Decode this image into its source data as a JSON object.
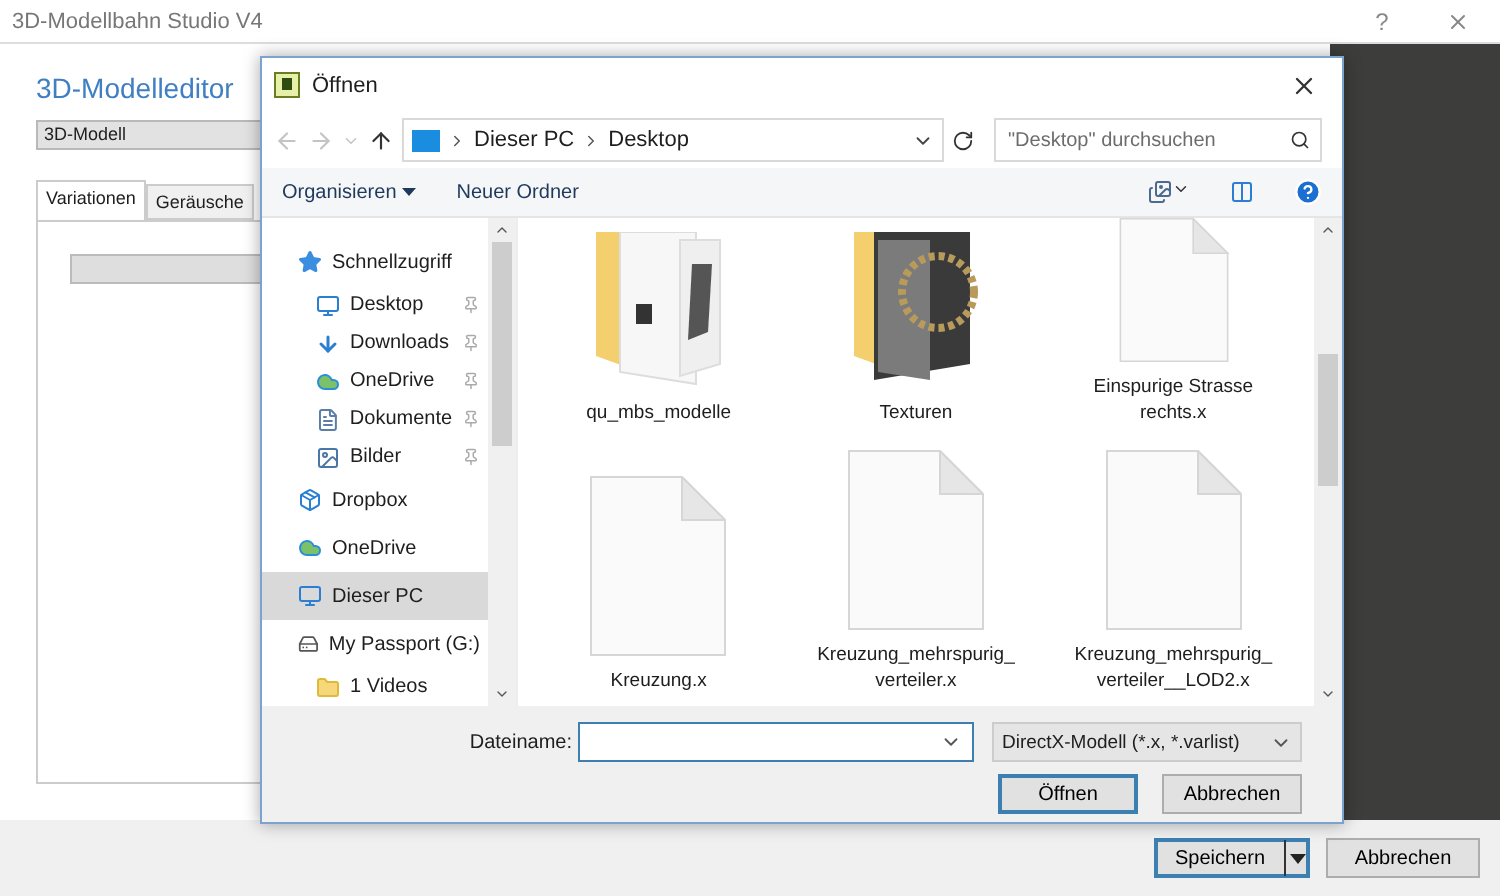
{
  "app": {
    "title": "3D-Modellbahn Studio V4",
    "help": "?",
    "heading": "3D-Modelleditor",
    "model_select": "3D-Modell",
    "tabs": [
      {
        "label": "Variationen",
        "selected": true
      },
      {
        "label": "Geräusche",
        "selected": false
      }
    ],
    "buttons": [
      {
        "label": "Speichern",
        "default": true,
        "split": true
      },
      {
        "label": "Abbrechen",
        "default": false,
        "split": false
      }
    ]
  },
  "dialog": {
    "title": "Öffnen",
    "path": [
      "Dieser PC",
      "Desktop"
    ],
    "search": {
      "placeholder": "\"Desktop\" durchsuchen"
    },
    "toolbar": [
      {
        "label": "Organisieren",
        "menu": true
      },
      {
        "label": "Neuer Ordner",
        "menu": false
      }
    ],
    "nav": [
      {
        "label": "Schnellzugriff",
        "kind": "star",
        "selected": false,
        "children": [
          {
            "label": "Desktop",
            "kind": "desktop",
            "pinned": true,
            "selected": false
          },
          {
            "label": "Downloads",
            "kind": "download",
            "pinned": true,
            "selected": false
          },
          {
            "label": "OneDrive",
            "kind": "cloud",
            "pinned": true,
            "selected": false
          },
          {
            "label": "Dokumente",
            "kind": "document",
            "pinned": true,
            "selected": false
          },
          {
            "label": "Bilder",
            "kind": "picture",
            "pinned": true,
            "selected": false
          }
        ]
      },
      {
        "label": "Dropbox",
        "kind": "dropbox",
        "selected": false
      },
      {
        "label": "OneDrive",
        "kind": "cloud",
        "selected": false
      },
      {
        "label": "Dieser PC",
        "kind": "desktop",
        "selected": true
      },
      {
        "label": "My Passport (G:)",
        "kind": "drive",
        "selected": false,
        "children": [
          {
            "label": "1 Videos",
            "kind": "folder",
            "selected": false
          }
        ]
      }
    ],
    "files": [
      {
        "label": "qu_mbs_modelle",
        "kind": "folder-photo"
      },
      {
        "label": "Texturen",
        "kind": "folder-texture"
      },
      {
        "label": "Einspurige Strasse rechts.x",
        "kind": "file"
      },
      {
        "label": "Kreuzung.x",
        "kind": "file"
      },
      {
        "label": "Kreuzung_mehrspurig_verteiler.x",
        "kind": "file"
      },
      {
        "label": "Kreuzung_mehrspurig_verteiler__LOD2.x",
        "kind": "file"
      }
    ],
    "filename": {
      "label": "Dateiname:"
    },
    "filetype": "DirectX-Modell (*.x, *.varlist)",
    "buttons": [
      {
        "label": "Öffnen",
        "default": true
      },
      {
        "label": "Abbrechen",
        "default": false
      }
    ]
  }
}
